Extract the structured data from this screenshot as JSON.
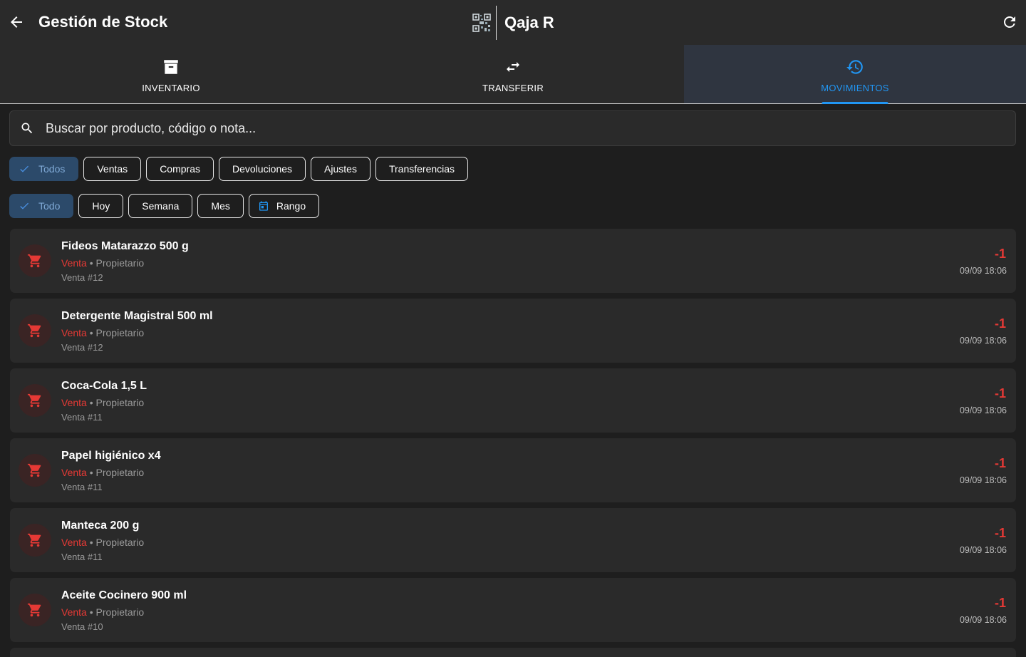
{
  "appbar": {
    "title": "Gestión de Stock",
    "brand_name": "Qaja R",
    "icons": {
      "back": "arrow-left-icon",
      "refresh": "refresh-icon",
      "brand": "qr-code-logo"
    }
  },
  "tabs": [
    {
      "label": "INVENTARIO",
      "icon": "archive-box-icon",
      "active": false
    },
    {
      "label": "TRANSFERIR",
      "icon": "swap-arrows-icon",
      "active": false
    },
    {
      "label": "MOVIMIENTOS",
      "icon": "history-icon",
      "active": true
    }
  ],
  "search": {
    "placeholder": "Buscar por producto, código o nota..."
  },
  "type_filters": [
    {
      "label": "Todos",
      "selected": true
    },
    {
      "label": "Ventas",
      "selected": false
    },
    {
      "label": "Compras",
      "selected": false
    },
    {
      "label": "Devoluciones",
      "selected": false
    },
    {
      "label": "Ajustes",
      "selected": false
    },
    {
      "label": "Transferencias",
      "selected": false
    }
  ],
  "period_filters": [
    {
      "label": "Todo",
      "selected": true
    },
    {
      "label": "Hoy",
      "selected": false
    },
    {
      "label": "Semana",
      "selected": false
    },
    {
      "label": "Mes",
      "selected": false
    },
    {
      "label": "Rango",
      "selected": false,
      "icon": "calendar-icon"
    }
  ],
  "movements": [
    {
      "product": "Fideos Matarazzo 500 g",
      "kind": "Venta",
      "separator": " • ",
      "user": "Propietario",
      "note": "Venta #12",
      "qty": "-1",
      "time": "09/09 18:06"
    },
    {
      "product": "Detergente Magistral 500 ml",
      "kind": "Venta",
      "separator": " • ",
      "user": "Propietario",
      "note": "Venta #12",
      "qty": "-1",
      "time": "09/09 18:06"
    },
    {
      "product": "Coca-Cola 1,5 L",
      "kind": "Venta",
      "separator": " • ",
      "user": "Propietario",
      "note": "Venta #11",
      "qty": "-1",
      "time": "09/09 18:06"
    },
    {
      "product": "Papel higiénico x4",
      "kind": "Venta",
      "separator": " • ",
      "user": "Propietario",
      "note": "Venta #11",
      "qty": "-1",
      "time": "09/09 18:06"
    },
    {
      "product": "Manteca 200 g",
      "kind": "Venta",
      "separator": " • ",
      "user": "Propietario",
      "note": "Venta #11",
      "qty": "-1",
      "time": "09/09 18:06"
    },
    {
      "product": "Aceite Cocinero 900 ml",
      "kind": "Venta",
      "separator": " • ",
      "user": "Propietario",
      "note": "Venta #10",
      "qty": "-1",
      "time": "09/09 18:06"
    }
  ],
  "colors": {
    "background": "#1e1e1e",
    "surface": "#2a2a2a",
    "accent": "#2196f3",
    "sale_red": "#e53935",
    "chip_selected": "#2c4a6a"
  }
}
